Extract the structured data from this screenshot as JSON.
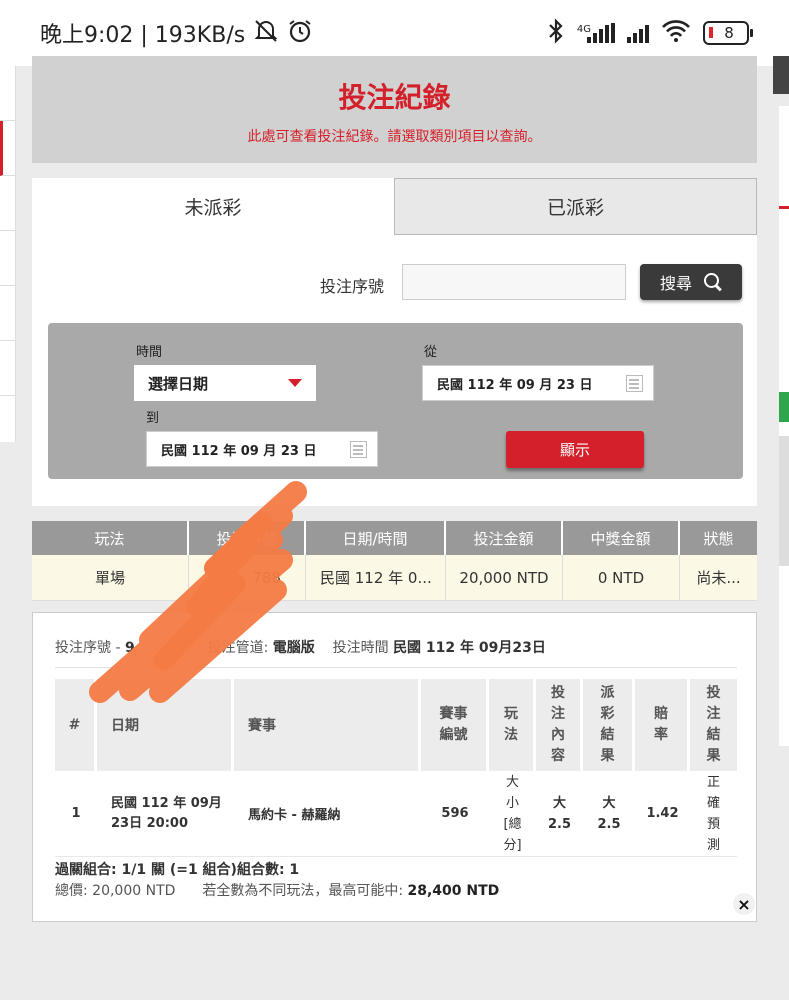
{
  "status_bar": {
    "time_speed": "晚上9:02 | 193KB/s",
    "network_label": "4G",
    "battery": "8"
  },
  "header": {
    "title": "投注紀錄",
    "subtitle": "此處可查看投注紀錄。請選取類別項目以查詢。"
  },
  "tabs": {
    "unsettled": "未派彩",
    "settled": "已派彩"
  },
  "search": {
    "label": "投注序號",
    "input_value": "",
    "button": "搜尋"
  },
  "filter": {
    "time_label": "時間",
    "select_value": "選擇日期",
    "from_label": "從",
    "from_value": "民國 112 年 09 月 23 日",
    "to_label": "到",
    "to_value": "民國 112 年 09 月 23 日",
    "show_button": "顯示"
  },
  "results_table": {
    "headers": [
      "玩法",
      "投注序號",
      "日期/時間",
      "投注金額",
      "中獎金額",
      "狀態"
    ],
    "rows": [
      [
        "單場",
        "788",
        "民國 112 年 0...",
        "20,000 NTD",
        "0 NTD",
        "尚未..."
      ]
    ]
  },
  "detail": {
    "meta_serial_label": "投注序號 -",
    "meta_serial_value": "9",
    "meta_channel_label": "投注管道:",
    "meta_channel_value": "電腦版",
    "meta_time_label": "投注時間",
    "meta_time_value": "民國 112 年 09月23日",
    "headers": [
      "#",
      "日期",
      "賽事",
      "賽事編號",
      "玩法",
      "投注內容",
      "派彩結果",
      "賠率",
      "投注結果"
    ],
    "row": {
      "index": "1",
      "date_line1": "民國 112 年 09月",
      "date_line2": "23日 20:00",
      "match": "馬約卡 - 赫羅納",
      "match_no": "596",
      "play": "大小[總分]",
      "bet_content": "大2.5",
      "payout_result": "大2.5",
      "odds": "1.42",
      "bet_result": "正確預測"
    },
    "combo_text": "過關組合: 1/1 關 (=1 組合)組合數: 1",
    "total_label": "總價:",
    "total_value": "20,000 NTD",
    "max_label": "若全數為不同玩法，最高可能中:",
    "max_value": "28,400 NTD",
    "close_symbol": "×"
  },
  "colors": {
    "accent_red": "#d4202a",
    "header_gray": "#d1d1d1",
    "table_head": "#999999",
    "row_highlight": "#fbf9e5",
    "scribble": "#f47b44"
  }
}
